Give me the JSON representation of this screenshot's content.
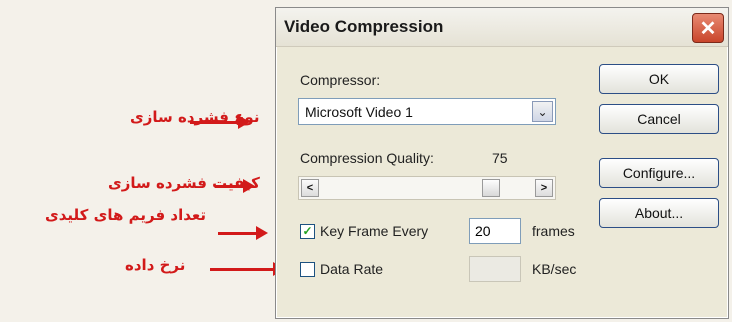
{
  "annotations": [
    {
      "text": "نوع فشرده سازی"
    },
    {
      "text": "کیفیت فشرده سازی"
    },
    {
      "text": "تعداد فریم های کلیدی"
    },
    {
      "text": "نرخ داده"
    }
  ],
  "dialog": {
    "title": "Video Compression",
    "close_glyph": "✕",
    "compressor_label": "Compressor:",
    "compressor_value": "Microsoft Video 1",
    "dropdown_glyph": "⌄",
    "quality_label": "Compression Quality:",
    "quality_value": "75",
    "quality_level_of_100": 75,
    "scroll_left_glyph": "<",
    "scroll_right_glyph": ">",
    "keyframe_label": "Key Frame Every",
    "keyframe_checked": true,
    "keyframe_value": "20",
    "frames_label": "frames",
    "datarate_label": "Data Rate",
    "datarate_checked": false,
    "datarate_unit": "KB/sec",
    "buttons": {
      "ok": "OK",
      "cancel": "Cancel",
      "configure": "Configure...",
      "about": "About..."
    }
  }
}
